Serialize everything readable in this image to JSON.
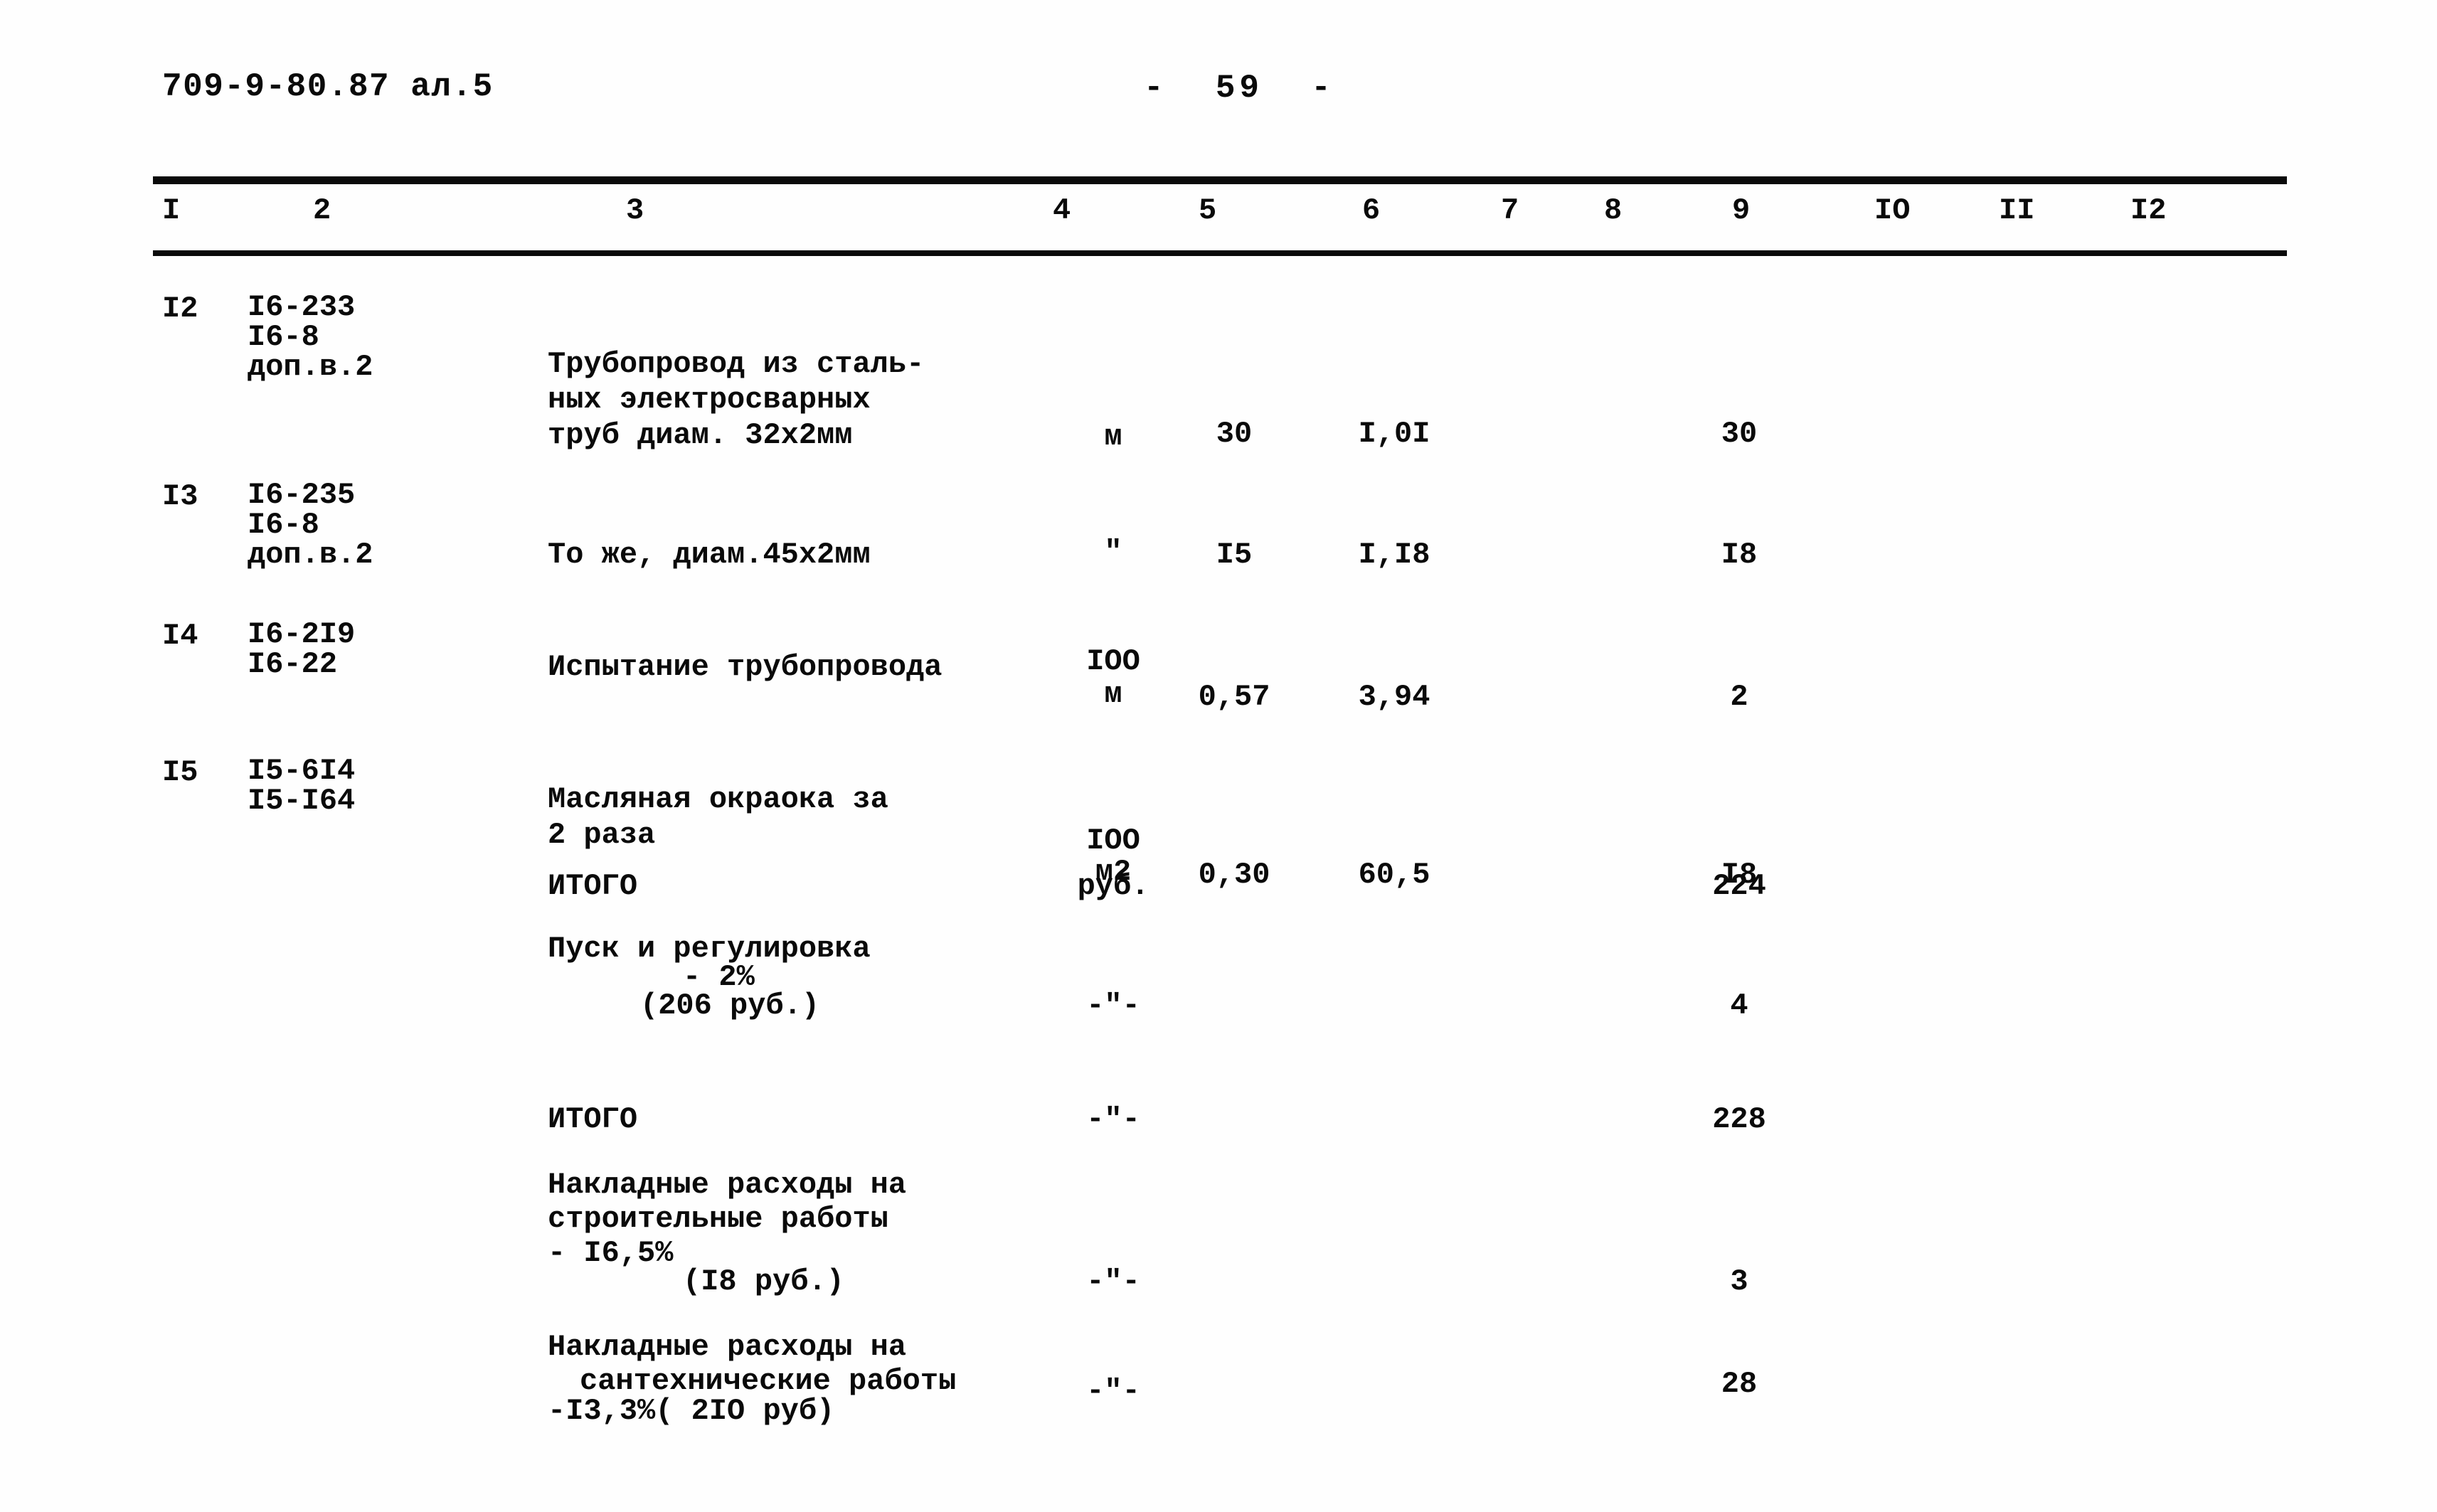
{
  "header": {
    "doc_code": "709-9-80.87 ал.5",
    "page_number": "-  59  -"
  },
  "table": {
    "column_headers": [
      "I",
      "2",
      "3",
      "4",
      "5",
      "6",
      "7",
      "8",
      "9",
      "IO",
      "II",
      "I2"
    ],
    "rows": [
      {
        "no": "I2",
        "codes": [
          "I6-233",
          "I6-8",
          "доп.в.2"
        ],
        "desc": [
          "Трубопровод из сталь-",
          "ных электросварных",
          "труб диам. 32х2мм"
        ],
        "unit": "м",
        "col5": "30",
        "col6": "I,0I",
        "col9": "30"
      },
      {
        "no": "I3",
        "codes": [
          "I6-235",
          "I6-8",
          "доп.в.2"
        ],
        "desc": [
          "То же, диам.45х2мм"
        ],
        "unit": "\"",
        "col5": "I5",
        "col6": "I,I8",
        "col9": "I8"
      },
      {
        "no": "I4",
        "codes": [
          "I6-2I9",
          "I6-22"
        ],
        "desc": [
          "Испытание трубопровода"
        ],
        "unit": "IOO\nм",
        "unit_line1": "IOO",
        "unit_line2": "м",
        "col5": "0,57",
        "col6": "3,94",
        "col9": "2"
      },
      {
        "no": "I5",
        "codes": [
          "I5-6I4",
          "I5-I64"
        ],
        "desc": [
          "Масляная окраока за",
          "2 раза"
        ],
        "unit_line1": "IOO",
        "unit_line2": "м2",
        "col5": "0,30",
        "col6": "60,5",
        "col9": "I8"
      }
    ],
    "summary_rows": [
      {
        "label": "ИТОГО",
        "unit": "руб.",
        "col9": "224"
      },
      {
        "label_line1": "Пуск и регулировка",
        "label_line2": "- 2%",
        "label_line3": "(206 руб.)",
        "unit": "-\"-",
        "col9": "4"
      },
      {
        "label": "ИТОГО",
        "unit": "-\"-",
        "col9": "228"
      },
      {
        "label_line1": "Накладные расходы на",
        "label_line2": "строительные работы",
        "label_line3": "- I6,5%",
        "label_line4": "(I8 руб.)",
        "unit": "-\"-",
        "col9": "3"
      },
      {
        "label_line1": "Накладные расходы на",
        "label_line2": "сантехнические работы",
        "label_line3": "-I3,3%( 2IO руб)",
        "unit": "-\"-",
        "col9": "28"
      }
    ]
  }
}
